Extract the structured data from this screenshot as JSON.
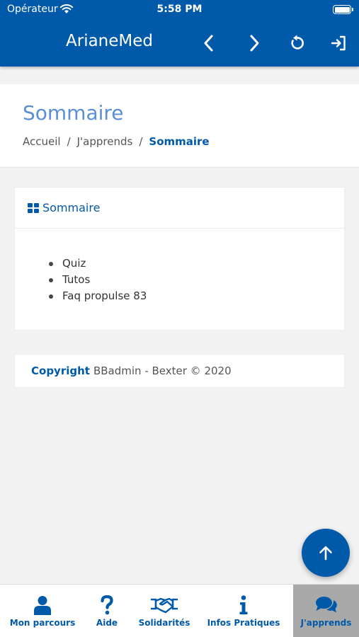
{
  "status_bar": {
    "carrier": "Opérateur",
    "time": "5:58 PM"
  },
  "nav": {
    "title": "ArianeMed"
  },
  "page": {
    "title": "Sommaire",
    "breadcrumb": [
      "Accueil",
      "J'apprends",
      "Sommaire"
    ]
  },
  "card": {
    "title": "Sommaire",
    "items": [
      "Quiz",
      "Tutos",
      "Faq propulse 83"
    ]
  },
  "footer": {
    "copyright_label": "Copyright",
    "copyright_text": "BBadmin - Bexter © 2020"
  },
  "tabs": [
    {
      "label": "Mon parcours",
      "icon": "user-icon"
    },
    {
      "label": "Aide",
      "icon": "question-icon"
    },
    {
      "label": "Solidarités",
      "icon": "handshake-icon"
    },
    {
      "label": "Infos Pratiques",
      "icon": "info-icon"
    },
    {
      "label": "J'apprends",
      "icon": "chat-icon",
      "active": true
    }
  ],
  "colors": {
    "primary": "#0059a9",
    "title_light": "#5a8ed6",
    "active_tab": "#a9a9a9",
    "background": "#f2f2f2"
  }
}
